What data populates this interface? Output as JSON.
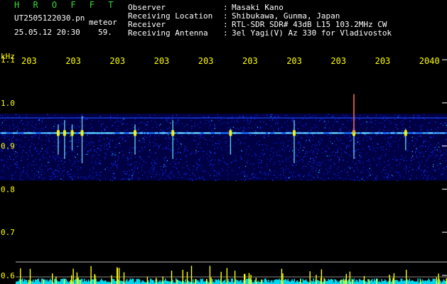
{
  "header": {
    "brand": "H R O F F T",
    "filename": "UT2505122030.pn",
    "meteor_label": "meteor",
    "datetime": "25.05.12 20:30",
    "count": "59.",
    "info": [
      {
        "label": "Observer",
        "value": "Masaki Kano"
      },
      {
        "label": "Receiving Location",
        "value": "Shibukawa, Gunma, Japan"
      },
      {
        "label": "Receiver",
        "value": "RTL-SDR SDR# 43dB L15 103.2MHz CW"
      },
      {
        "label": "Receiving Antenna",
        "value": "3el Yagi(V) Az 330 for Vladivostok"
      }
    ]
  },
  "chart_data": {
    "type": "heatmap",
    "yunit": "kHz",
    "y_ticks": [
      "1.1",
      "1.0",
      "0.9",
      "0.8",
      "0.7",
      "0.6"
    ],
    "x_ticks": [
      "203",
      "203",
      "203",
      "203",
      "203",
      "203",
      "203",
      "203",
      "203",
      "2040"
    ],
    "ylim": [
      0.58,
      1.12
    ],
    "band": {
      "low": 0.82,
      "high": 0.975
    },
    "trace": 0.93,
    "meteors": [
      {
        "minute": 2030.57,
        "low": 0.88,
        "high": 0.95
      },
      {
        "minute": 2030.73,
        "low": 0.87,
        "high": 0.96
      },
      {
        "minute": 2030.92,
        "low": 0.89,
        "high": 0.95
      },
      {
        "minute": 2031.17,
        "low": 0.86,
        "high": 0.97
      },
      {
        "minute": 2032.5,
        "low": 0.88,
        "high": 0.95
      },
      {
        "minute": 2033.45,
        "low": 0.87,
        "high": 0.96
      },
      {
        "minute": 2034.9,
        "low": 0.88,
        "high": 0.94
      },
      {
        "minute": 2036.5,
        "low": 0.86,
        "high": 0.96
      },
      {
        "minute": 2038.0,
        "low": 0.87,
        "high": 1.02
      },
      {
        "minute": 2039.3,
        "low": 0.89,
        "high": 0.94
      }
    ],
    "colors": {
      "axis_text": "#ffff00",
      "trace": "#66e0ff",
      "noise": "#00e5ff",
      "peak": "#ffff00",
      "tick": "#ffffff"
    }
  }
}
